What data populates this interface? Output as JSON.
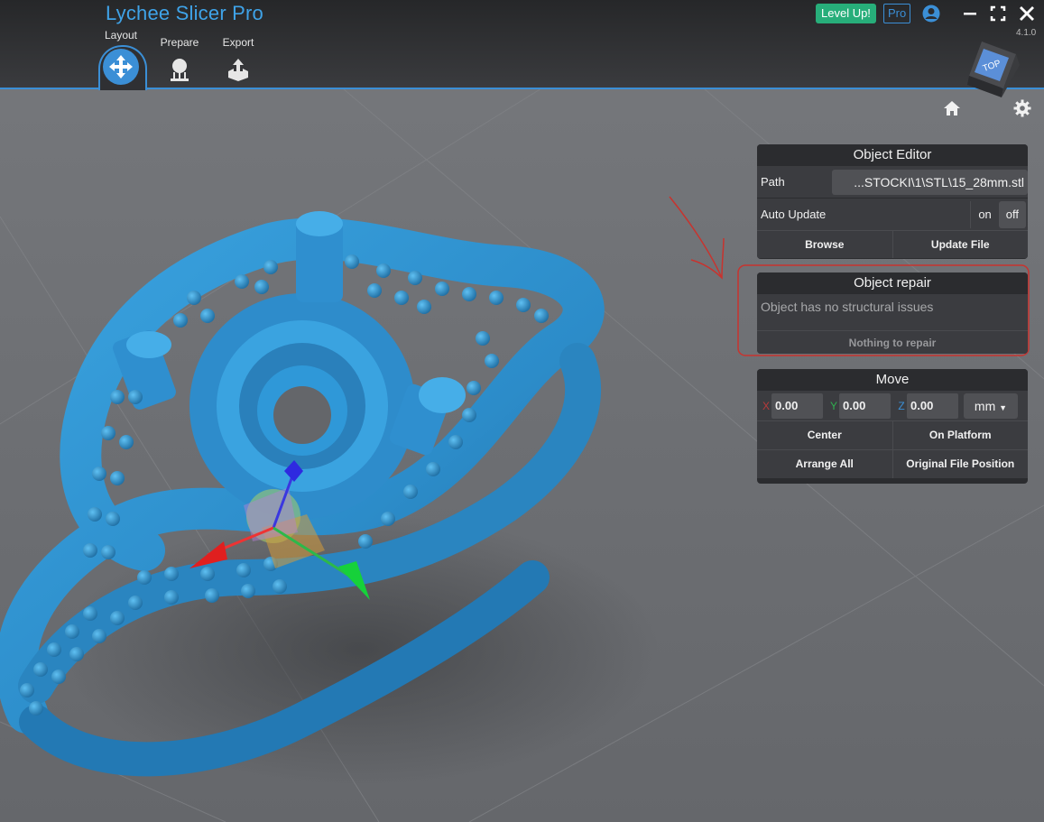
{
  "app": {
    "title": "Lychee Slicer Pro",
    "version": "4.1.0"
  },
  "header": {
    "tabs": [
      {
        "label": "Layout",
        "icon": "move-arrows-icon",
        "active": true
      },
      {
        "label": "Prepare",
        "icon": "support-tree-icon"
      },
      {
        "label": "Export",
        "icon": "export-tray-icon"
      }
    ],
    "level_up": "Level Up!",
    "pro": "Pro",
    "accent": "#3b8fd6",
    "level_up_color": "#27ae7a"
  },
  "viewcube": {
    "face": "TOP"
  },
  "object_editor": {
    "title": "Object Editor",
    "path_label": "Path",
    "path_value": "...STOCKI\\1\\STL\\15_28mm.stl",
    "auto_update_label": "Auto Update",
    "toggle_on": "on",
    "toggle_off": "off",
    "browse": "Browse",
    "update_file": "Update File"
  },
  "object_repair": {
    "title": "Object repair",
    "message": "Object has no structural issues",
    "button": "Nothing to repair"
  },
  "move": {
    "title": "Move",
    "x_label": "X",
    "x_value": "0.00",
    "y_label": "Y",
    "y_value": "0.00",
    "z_label": "Z",
    "z_value": "0.00",
    "unit": "mm",
    "center": "Center",
    "on_platform": "On Platform",
    "arrange_all": "Arrange All",
    "original_position": "Original File Position"
  },
  "model": {
    "color": "#2f8fcf"
  }
}
